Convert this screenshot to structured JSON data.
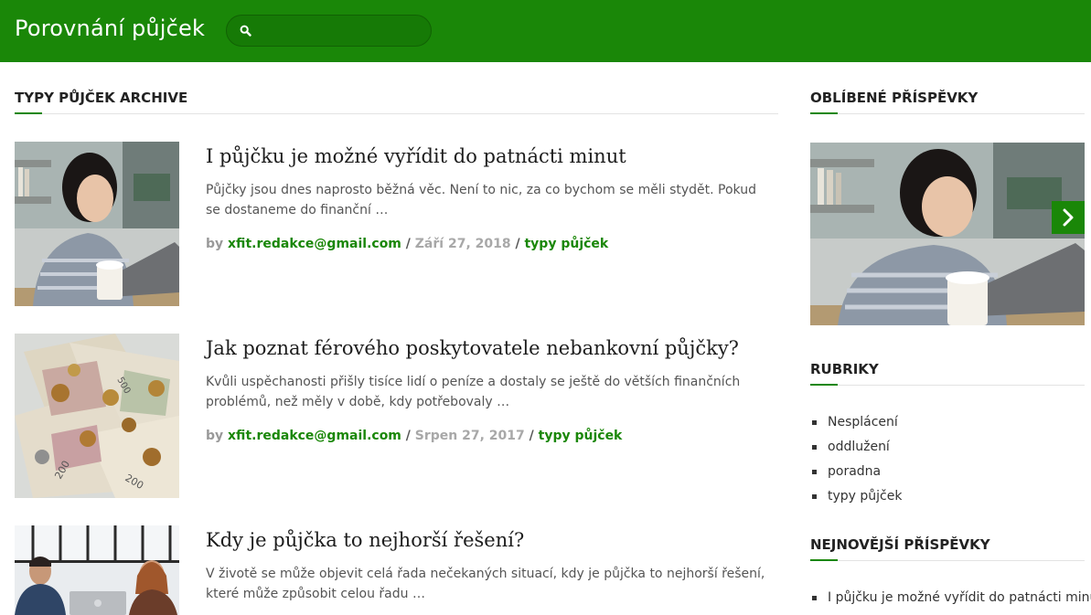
{
  "header": {
    "site_title": "Porovnání půjček",
    "search_placeholder": ""
  },
  "archive": {
    "title": "TYPY PŮJČEK ARCHIVE"
  },
  "posts": [
    {
      "title": "I půjčku je možné vyřídit do patnácti minut",
      "excerpt": "Půjčky jsou dnes naprosto běžná věc. Není to nic, za co bychom se měli stydět. Pokud se dostaneme do finanční …",
      "by": "by",
      "author": "xfit.redakce@gmail.com",
      "date": "Září 27, 2018",
      "category": "typy půjček",
      "thumb": "woman-laptop-photo"
    },
    {
      "title": "Jak poznat férového poskytovatele nebankovní půjčky?",
      "excerpt": "Kvůli uspěchanosti přišly tisíce lidí o peníze a dostaly se ještě do větších finančních problémů, než měly v době, kdy potřebovaly …",
      "by": "by",
      "author": "xfit.redakce@gmail.com",
      "date": "Srpen 27, 2017",
      "category": "typy půjček",
      "thumb": "banknotes-coins-photo"
    },
    {
      "title": "Kdy je půjčka to nejhorší řešení?",
      "excerpt": "V životě se může objevit celá řada nečekaných situací, kdy je půjčka to nejhorší řešení, které může způsobit celou řadu …",
      "thumb": "people-meeting-photo"
    }
  ],
  "sidebar": {
    "popular_title": "OBLÍBENÉ PŘÍSPĚVKY",
    "categories_title": "RUBRIKY",
    "categories": [
      "Nesplácení",
      "oddlužení",
      "poradna",
      "typy půjček"
    ],
    "recent_title": "NEJNOVĚJŠÍ PŘÍSPĚVKY",
    "recent": [
      "I půjčku je možné vyřídit do patnácti minut"
    ]
  },
  "colors": {
    "brand_green": "#1a8708",
    "text_dark": "#222222",
    "meta_gray": "#a8a8a8"
  }
}
